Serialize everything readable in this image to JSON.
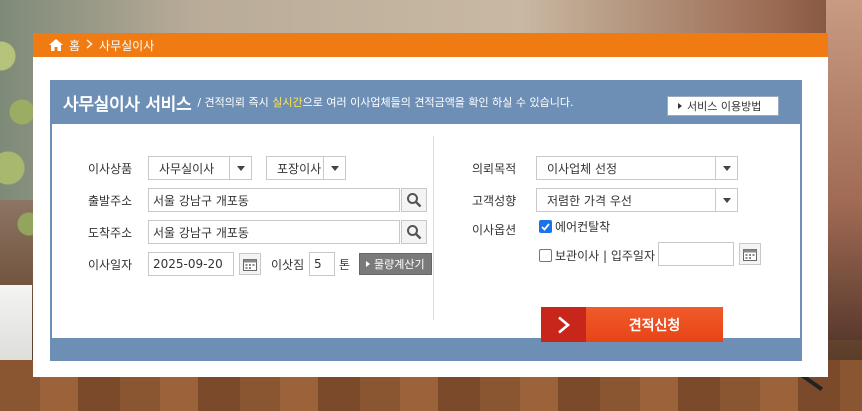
{
  "breadcrumb": {
    "home": "홈",
    "current": "사무실이사"
  },
  "header": {
    "title": "사무실이사 서비스",
    "desc_prefix": "/ 견적의뢰 즉시 ",
    "desc_highlight": "실시간",
    "desc_suffix": "으로 여러 이사업체들의 견적금액을 확인 하실 수 있습니다.",
    "guide_button": "서비스 이용방법"
  },
  "form_left": {
    "product_label": "이사상품",
    "product_value": "사무실이사",
    "pack_value": "포장이사",
    "from_label": "출발주소",
    "from_value": "서울 강남구 개포동",
    "to_label": "도착주소",
    "to_value": "서울 강남구 개포동",
    "date_label": "이사일자",
    "date_value": "2025-09-20",
    "load_label": "이삿짐",
    "load_value": "5",
    "load_unit": "톤",
    "calc_button": "물량계산기"
  },
  "form_right": {
    "purpose_label": "의뢰목적",
    "purpose_value": "이사업체 선정",
    "tendency_label": "고객성향",
    "tendency_value": "저렴한 가격 우선",
    "option_label": "이사옵션",
    "option_aircon": "에어컨탈착",
    "option_storage": "보관이사 | 입주일자",
    "storage_date": "",
    "submit_button": "견적신청"
  },
  "colors": {
    "orange": "#f07b12",
    "blue_box": "#6d8fb5",
    "submit": "#e84416",
    "highlight": "#ffe44d"
  }
}
